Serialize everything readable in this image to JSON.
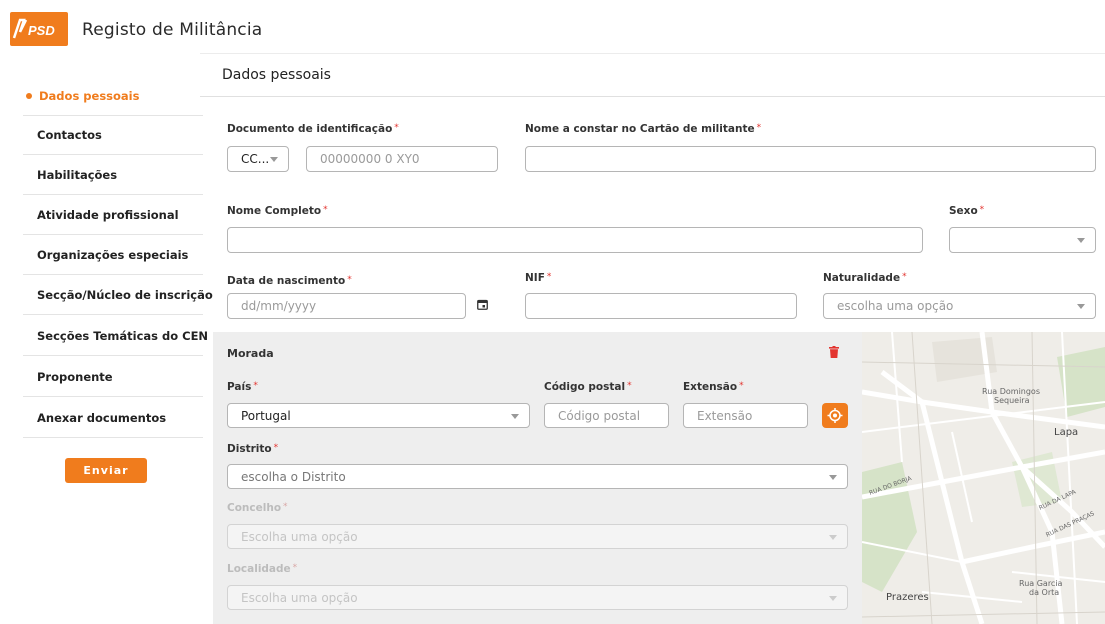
{
  "header": {
    "logo_text": "PSD",
    "title": "Registo de Militância"
  },
  "sidebar": {
    "items": [
      {
        "label": "Dados pessoais",
        "active": true
      },
      {
        "label": "Contactos"
      },
      {
        "label": "Habilitações"
      },
      {
        "label": "Atividade profissional"
      },
      {
        "label": "Organizações especiais"
      },
      {
        "label": "Secção/Núcleo de inscrição"
      },
      {
        "label": "Secções Temáticas do CEN"
      },
      {
        "label": "Proponente"
      },
      {
        "label": "Anexar documentos"
      }
    ],
    "submit_label": "Enviar"
  },
  "main": {
    "section_title": "Dados pessoais",
    "doc_id": {
      "label": "Documento de identificação",
      "type_value": "CC...",
      "placeholder": "00000000 0 XY0"
    },
    "card_name": {
      "label": "Nome a constar no Cartão de militante",
      "value": ""
    },
    "full_name": {
      "label": "Nome Completo",
      "value": ""
    },
    "sex": {
      "label": "Sexo",
      "value": ""
    },
    "birth_date": {
      "label": "Data de nascimento",
      "placeholder": "dd/mm/yyyy"
    },
    "nif": {
      "label": "NIF",
      "value": ""
    },
    "naturality": {
      "label": "Naturalidade",
      "placeholder": "escolha uma opção"
    },
    "required_mark": "*"
  },
  "address": {
    "title": "Morada",
    "country": {
      "label": "País",
      "value": "Portugal"
    },
    "postal_code": {
      "label": "Código postal",
      "placeholder": "Código postal"
    },
    "extension": {
      "label": "Extensão",
      "placeholder": "Extensão"
    },
    "district": {
      "label": "Distrito",
      "placeholder": "escolha o Distrito"
    },
    "county": {
      "label": "Concelho",
      "placeholder": "Escolha uma opção"
    },
    "locality": {
      "label": "Localidade",
      "placeholder": "Escolha uma opção"
    }
  },
  "map": {
    "labels": {
      "rua_domingos": "Rua Domingos",
      "sequeira": "Sequeira",
      "lapa": "Lapa",
      "rua_do_borja": "RUA DO BORJA",
      "rua_da_lapa": "RUA DA LAPA",
      "rua_das_pracas": "RUA DAS PRAÇAS",
      "rua_garcia": "Rua Garcia",
      "da_orta": "da Orta",
      "prazeres": "Prazeres"
    }
  },
  "colors": {
    "accent": "#f07c1d",
    "required": "#e3342f",
    "panel": "#eeeeee"
  }
}
